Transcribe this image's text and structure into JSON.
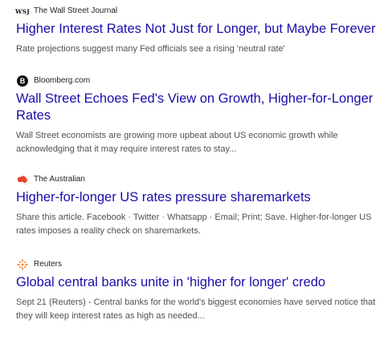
{
  "results": [
    {
      "source": "The Wall Street Journal",
      "icon": "wsj-logo-icon",
      "icon_text": "WSJ",
      "title": "Higher Interest Rates Not Just for Longer, but Maybe Forever",
      "snippet": "Rate projections suggest many Fed officials see a rising 'neutral rate'"
    },
    {
      "source": "Bloomberg.com",
      "icon": "bloomberg-logo-icon",
      "icon_text": "B",
      "title": "Wall Street Echoes Fed's View on Growth, Higher-for-Longer Rates",
      "snippet": "Wall Street economists are growing more upbeat about US economic growth while acknowledging that it may require interest rates to stay..."
    },
    {
      "source": "The Australian",
      "icon": "australia-map-icon",
      "title": "Higher-for-longer US rates pressure sharemarkets",
      "snippet": "Share this article. Facebook · Twitter · Whatsapp · Email; Print; Save. Higher-for-longer US rates imposes a reality check on sharemarkets."
    },
    {
      "source": "Reuters",
      "icon": "reuters-logo-icon",
      "title": "Global central banks unite in 'higher for longer' credo",
      "snippet": "Sept 21 (Reuters) - Central banks for the world's biggest economies have served notice that they will keep interest rates as high as needed..."
    }
  ],
  "colors": {
    "link": "#1a0dab",
    "snippet": "#4d5156",
    "source": "#202124",
    "australian_red": "#e8452c",
    "reuters_orange": "#f07e26"
  }
}
